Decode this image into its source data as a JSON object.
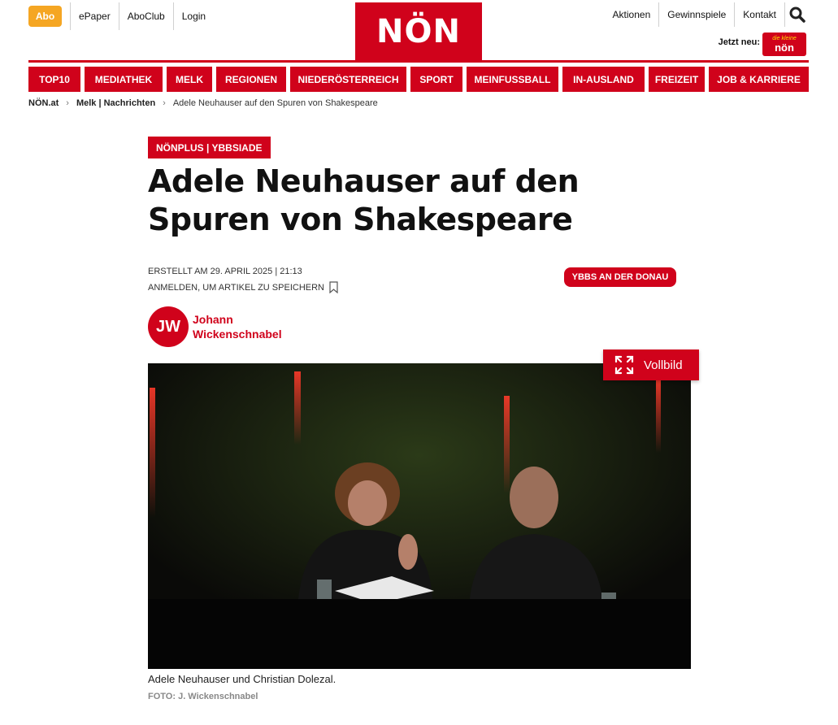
{
  "topbar": {
    "abo_label": "Abo",
    "links": [
      "ePaper",
      "AboClub",
      "Login"
    ],
    "logo": "NÖN",
    "right_links": [
      "Aktionen",
      "Gewinnspiele",
      "Kontakt"
    ],
    "jetzt_neu": "Jetzt neu:",
    "kleine_top": "die kleine",
    "kleine_bottom": "nön"
  },
  "nav": {
    "items": [
      "TOP10",
      "MEDIATHEK",
      "MELK",
      "REGIONEN",
      "NIEDERÖSTERREICH",
      "SPORT",
      "MEINFUSSBALL",
      "IN-AUSLAND",
      "FREIZEIT",
      "JOB & KARRIERE"
    ]
  },
  "breadcrumb": {
    "home": "NÖN.at",
    "section": "Melk | Nachrichten",
    "current": "Adele Neuhauser auf den Spuren von Shakespeare"
  },
  "article": {
    "kicker": "NÖNPLUS | YBBSIADE",
    "headline": "Adele Neuhauser auf den Spuren von Shakespeare",
    "created": "ERSTELLT AM 29. APRIL 2025 | 21:13",
    "save_prompt": "ANMELDEN, UM ARTIKEL ZU SPEICHERN",
    "location": "YBBS AN DER DONAU",
    "author_initials": "JW",
    "author_first": "Johann",
    "author_last": "Wickenschnabel",
    "vollbild": "Vollbild",
    "caption": "Adele Neuhauser und Christian Dolezal.",
    "credit": "FOTO: J. Wickenschnabel"
  },
  "colors": {
    "brand_red": "#d0021b",
    "abo_orange": "#f5a623"
  }
}
